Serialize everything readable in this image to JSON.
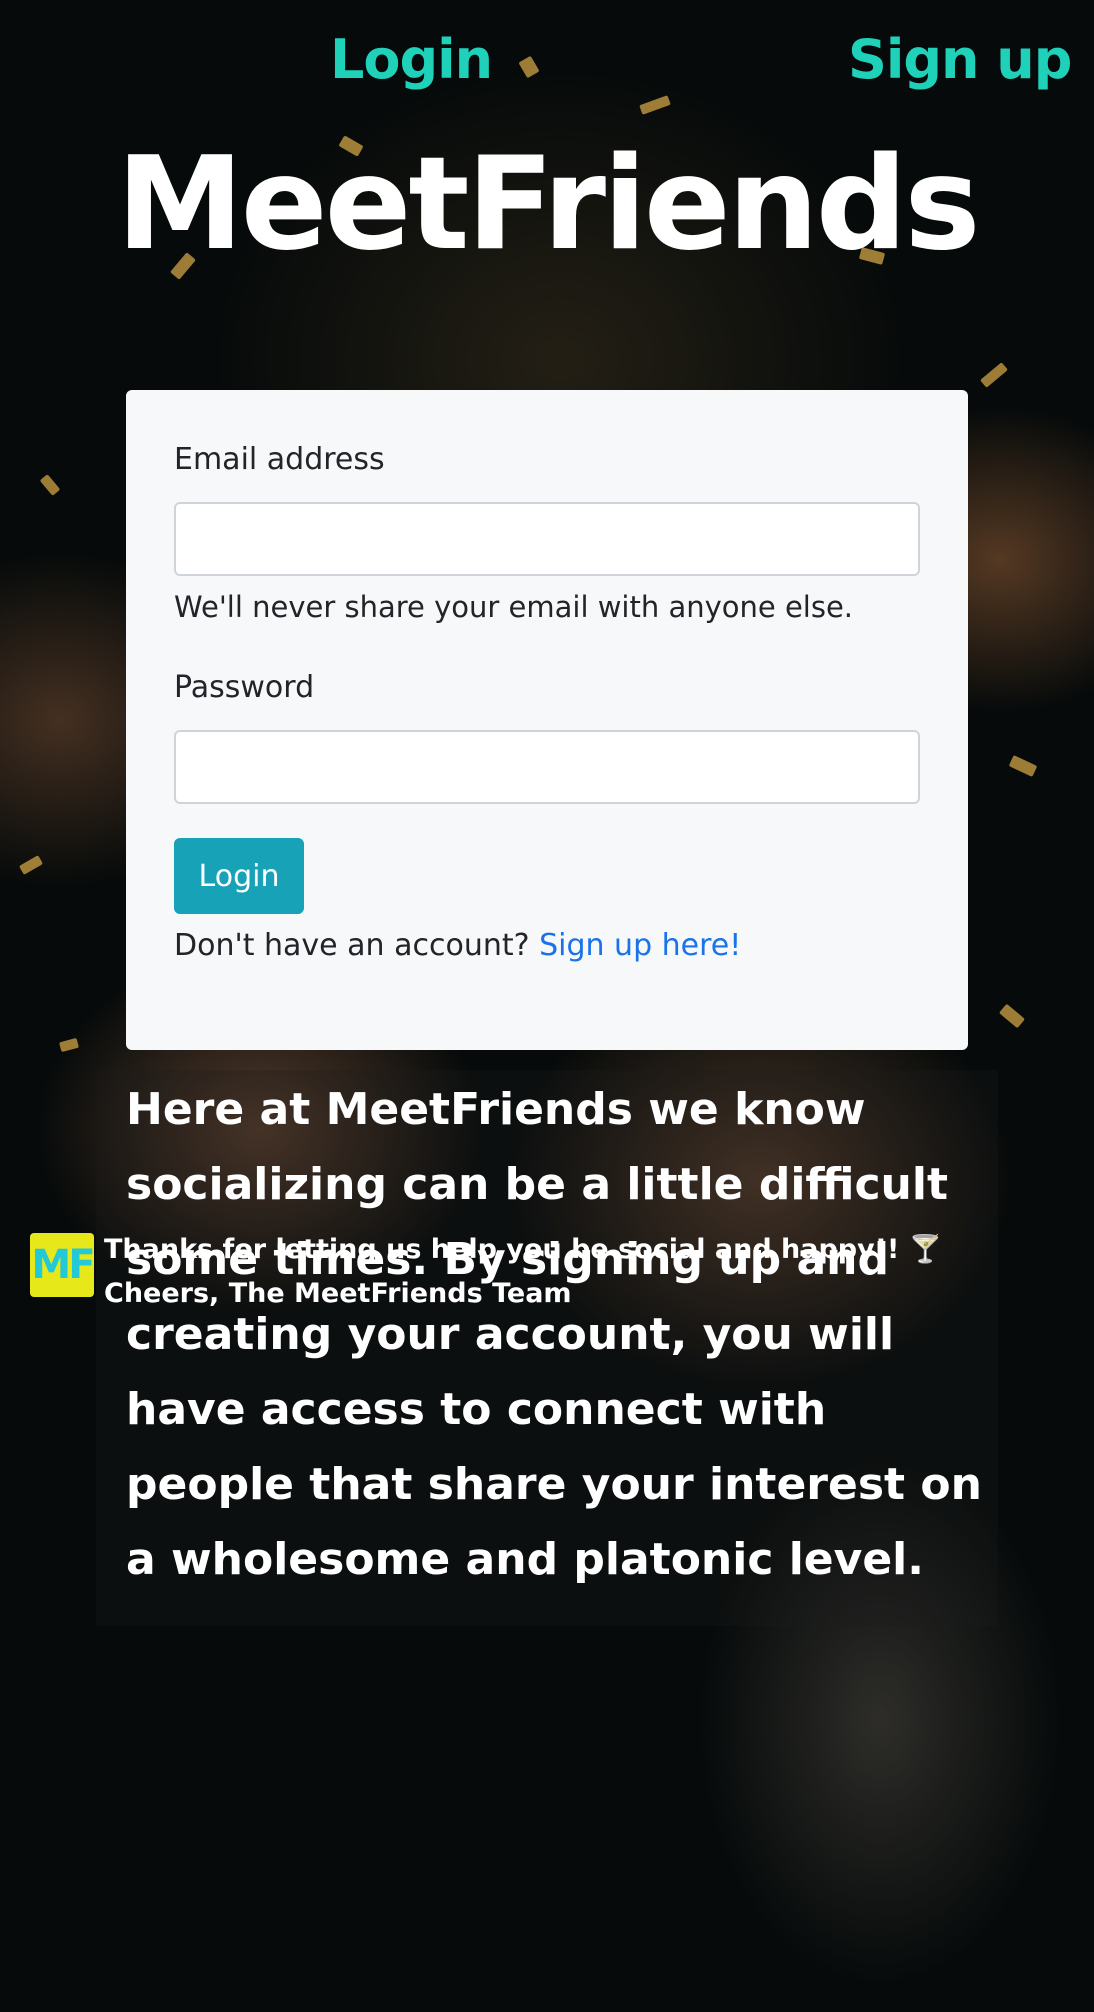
{
  "nav": {
    "login": "Login",
    "signup": "Sign up"
  },
  "brand": "MeetFriends",
  "form": {
    "email_label": "Email address",
    "email_value": "",
    "email_help": "We'll never share your email with anyone else.",
    "password_label": "Password",
    "password_value": "",
    "login_button": "Login",
    "signup_prompt": "Don't have an account? ",
    "signup_link": "Sign up here!"
  },
  "about": "Here at MeetFriends we know socializing can be a little difficult some times. By signing up and creating your account, you will have access to connect with people that share your interest on a wholesome and platonic level.",
  "footer": {
    "logo": "MF",
    "message": "Thanks for letting us help you be social and happy!! 🍸 Cheers, The MeetFriends Team"
  },
  "colors": {
    "accent": "#1fd1b9",
    "button": "#17a2b8",
    "link": "#1a73e8",
    "card": "#f7f8f9"
  }
}
